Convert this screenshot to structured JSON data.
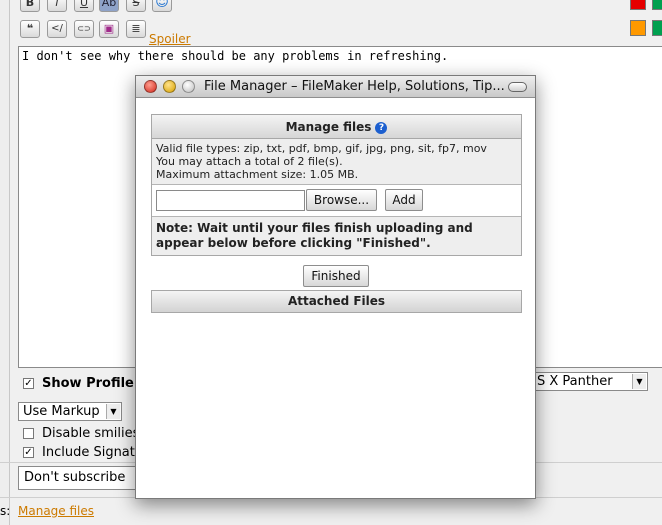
{
  "toolbar": {
    "row1": [
      {
        "name": "bold-button",
        "glyph": "B"
      },
      {
        "name": "italic-button",
        "glyph": "I"
      },
      {
        "name": "underline-button",
        "glyph": "U"
      },
      {
        "name": "font-style-button",
        "glyph": "Ab"
      },
      {
        "name": "strikethrough-button",
        "glyph": "S"
      },
      {
        "name": "smiley-button",
        "glyph": "☺"
      }
    ],
    "row2": [
      {
        "name": "quote-button",
        "glyph": "❝"
      },
      {
        "name": "code-button",
        "glyph": "</"
      },
      {
        "name": "link-button",
        "glyph": "⊂⊃"
      },
      {
        "name": "image-button",
        "glyph": "▣"
      },
      {
        "name": "list-button",
        "glyph": "≣"
      }
    ],
    "spoiler_label": "Spoiler",
    "swatch_colors": [
      "#e60000",
      "#00a050",
      "#ff9900",
      "#00a050"
    ]
  },
  "editor": {
    "text": "I don't see why there should be any problems in refreshing."
  },
  "options": {
    "show_profile_label": "Show Profile:",
    "os_select_value": "S X Panther",
    "markup_select_value": "Use Markup",
    "disable_smilies_label": "Disable smilies",
    "include_signature_label": "Include Signature",
    "subscribe_value": "Don't subscribe",
    "manage_files_link": "Manage files",
    "row_label": "s:"
  },
  "window": {
    "title": "File Manager – FileMaker Help, Solutions, Tip...",
    "manage_files_header": "Manage files",
    "info_lines": [
      "Valid file types: zip, txt, pdf, bmp, gif, jpg, png, sit, fp7, mov",
      "You may attach a total of 2 file(s).",
      "Maximum attachment size: 1.05 MB."
    ],
    "browse_label": "Browse...",
    "add_label": "Add",
    "note": "Note: Wait until your files finish uploading and appear below before clicking \"Finished\".",
    "finished_label": "Finished",
    "attached_header": "Attached Files"
  }
}
